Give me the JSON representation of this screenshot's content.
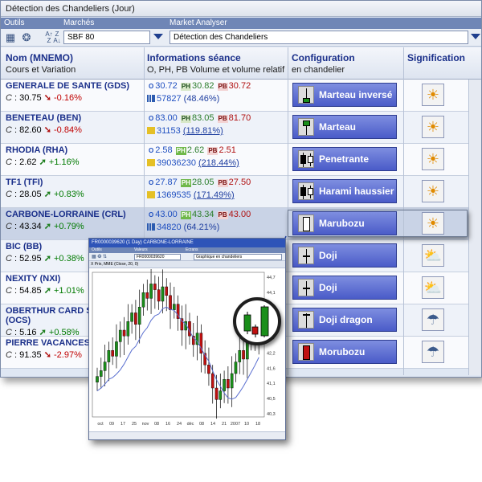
{
  "window": {
    "title": "Détection des Chandeliers (Jour)"
  },
  "toolbar": {
    "labels": {
      "tools": "Outils",
      "markets": "Marchés",
      "analyser": "Market Analyser"
    },
    "market_value": "SBF 80",
    "analyser_value": "Détection des Chandeliers",
    "icons": [
      "calculator-icon",
      "globe-icon",
      "sort-az-icon",
      "sort-za-icon"
    ]
  },
  "columns": {
    "name": {
      "title": "Nom (MNEMO)",
      "sub": "Cours et Variation"
    },
    "info": {
      "title": "Informations séance",
      "sub": "O, PH, PB Volume et volume relatif"
    },
    "config": {
      "title": "Configuration",
      "sub": "en chandelier"
    },
    "signif": {
      "title": "Signification"
    }
  },
  "labels": {
    "o_tag": "O",
    "ph_tag": "PH",
    "pb_tag": "PB",
    "c_tag": "C"
  },
  "rows": [
    {
      "name": "GENERALE DE SANTE (GDS)",
      "close": "30.75",
      "variation": "-0.16%",
      "dir": "down",
      "open": "30.72",
      "high": "30.82",
      "low": "30.72",
      "volume": "57827",
      "rel": "(48.46%)",
      "rel_ul": false,
      "config": "Marteau inversé",
      "candle": "inv-hammer",
      "signif": "sun",
      "signif_icon": "sun-icon"
    },
    {
      "name": "BENETEAU (BEN)",
      "close": "82.60",
      "variation": "-0.84%",
      "dir": "down",
      "open": "83.00",
      "high": "83.05",
      "low": "81.70",
      "volume": "31153",
      "rel": "(119.81%)",
      "rel_ul": true,
      "config": "Marteau",
      "candle": "hammer",
      "signif": "sun",
      "signif_icon": "sun-icon"
    },
    {
      "name": "RHODIA (RHA)",
      "close": "2.62",
      "variation": "+1.16%",
      "dir": "up",
      "open": "2.58",
      "high": "2.62",
      "low": "2.51",
      "volume": "39036230",
      "rel": "(218.44%)",
      "rel_ul": true,
      "ph_hi": true,
      "config": "Penetrante",
      "candle": "piercing",
      "signif": "sun",
      "signif_icon": "sun-icon"
    },
    {
      "name": "TF1 (TFI)",
      "close": "28.05",
      "variation": "+0.83%",
      "dir": "up",
      "open": "27.87",
      "high": "28.05",
      "low": "27.50",
      "volume": "1369535",
      "rel": "(171.49%)",
      "rel_ul": true,
      "ph_hi": true,
      "config": "Harami haussier",
      "candle": "harami",
      "signif": "sun",
      "signif_icon": "sun-icon"
    },
    {
      "name": "CARBONE-LORRAINE (CRL)",
      "close": "43.34",
      "variation": "+0.79%",
      "dir": "up",
      "open": "43.00",
      "high": "43.34",
      "low": "43.00",
      "volume": "34820",
      "rel": "(64.21%)",
      "rel_ul": false,
      "ph_hi": true,
      "config": "Marubozu",
      "candle": "marubozu",
      "signif": "sun",
      "signif_icon": "sun-icon"
    },
    {
      "name": "BIC (BB)",
      "close": "52.95",
      "variation": "+0.38%",
      "dir": "up",
      "config": "Doji",
      "candle": "doji",
      "signif": "cloud",
      "signif_icon": "sun-cloud-icon"
    },
    {
      "name": "NEXITY (NXI)",
      "close": "54.85",
      "variation": "+1.01%",
      "dir": "up",
      "config": "Doji",
      "candle": "doji",
      "signif": "cloud",
      "signif_icon": "sun-cloud-icon"
    },
    {
      "name": "OBERTHUR CARD S",
      "name2": "(OCS)",
      "close": "5.16",
      "variation": "+0.58%",
      "dir": "up",
      "config": "Doji dragon",
      "candle": "dragon",
      "signif": "rain",
      "signif_icon": "rain-cloud-icon"
    },
    {
      "name": "PIERRE VACANCES",
      "close": "91.35",
      "variation": "-2.97%",
      "dir": "down",
      "config": "Morubozu",
      "candle": "red-marubozu",
      "signif": "rain",
      "signif_icon": "rain-cloud-icon"
    }
  ],
  "popup": {
    "title": "FR0000039620 (1 Day) CARBONE-LORRAINE",
    "tb_labels": [
      "Outils",
      "Valeurs",
      "Ecrans"
    ],
    "code": "FR0000039620",
    "view": "Graphique en chandeliers",
    "legend": "X Prix, MME (Close, 20, 0)",
    "x_ticks": [
      "oct",
      "09",
      "17",
      "25",
      "nov",
      "08",
      "16",
      "24",
      "déc",
      "08",
      "14",
      "21",
      "2007",
      "10",
      "18"
    ],
    "y_ticks": [
      "44,7",
      "44,1",
      "43,6",
      "43,2",
      "42,7",
      "42,2",
      "41,6",
      "41,1",
      "40,5",
      "40,3"
    ],
    "colors": {
      "up": "#1a8f1a",
      "down": "#c01010",
      "ma": "#5a6fd0"
    }
  }
}
